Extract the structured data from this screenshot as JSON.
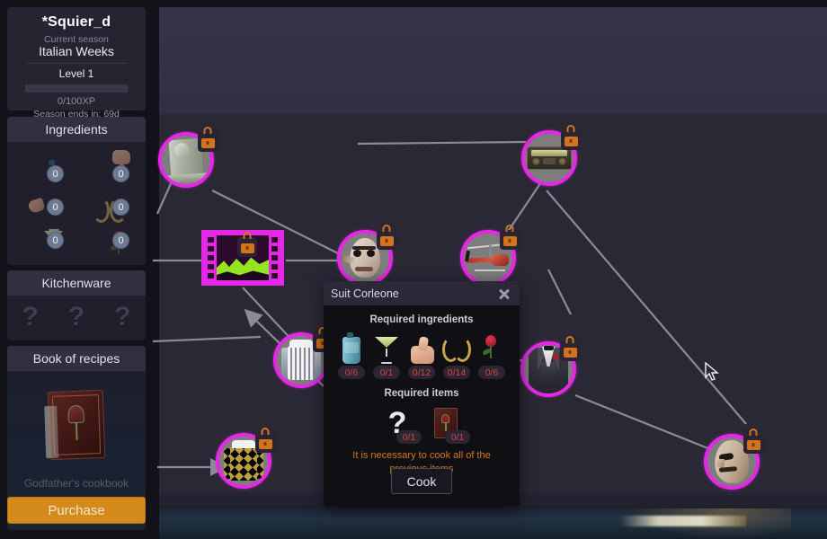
{
  "profile": {
    "name": "*Squier_d",
    "season_label": "Current season",
    "season_name": "Italian Weeks",
    "level": "Level 1",
    "xp_text": "0/100XP",
    "xp_percent": 0,
    "season_ends": "Season ends in: 69d"
  },
  "sidebar": {
    "ingredients_title": "Ingredients",
    "kitchenware_title": "Kitchenware",
    "recipes_title": "Book of recipes",
    "ingredients": [
      {
        "icon": "water-jug-icon",
        "count": "0"
      },
      {
        "icon": "thumbs-up-icon",
        "count": "0"
      },
      {
        "icon": "pinched-fingers-icon",
        "count": "0"
      },
      {
        "icon": "laurel-wreath-icon",
        "count": "0"
      },
      {
        "icon": "martini-glass-icon",
        "count": "0"
      },
      {
        "icon": "rose-icon",
        "count": "0"
      }
    ],
    "kitchenware_slots": [
      "?",
      "?",
      "?"
    ],
    "book": {
      "title": "Godfather's cookbook",
      "purchase_label": "Purchase"
    }
  },
  "dialog": {
    "title": "Suit Corleone",
    "close_icon": "close-icon",
    "required_ingredients_title": "Required ingredients",
    "required_ingredients": [
      {
        "icon": "water-jug-icon",
        "count": "0/6"
      },
      {
        "icon": "martini-glass-icon",
        "count": "0/1"
      },
      {
        "icon": "thumbs-up-icon",
        "count": "0/12"
      },
      {
        "icon": "laurel-wreath-icon",
        "count": "0/14"
      },
      {
        "icon": "rose-icon",
        "count": "0/6"
      }
    ],
    "required_items_title": "Required items",
    "required_items": [
      {
        "icon": "unknown-item-icon",
        "count": "0/1"
      },
      {
        "icon": "cookbook-icon",
        "count": "0/1"
      }
    ],
    "warning": "It is necessary to cook all of the previous items",
    "cook_label": "Cook"
  },
  "graph": {
    "nodes": [
      {
        "id": "statue",
        "name": "node-statue",
        "locked": true
      },
      {
        "id": "film",
        "name": "node-film",
        "locked": true
      },
      {
        "id": "mask",
        "name": "node-mask",
        "locked": true
      },
      {
        "id": "boombox",
        "name": "node-boombox",
        "locked": true
      },
      {
        "id": "heli",
        "name": "node-helicopter",
        "locked": true
      },
      {
        "id": "shirt",
        "name": "node-shirt",
        "locked": true
      },
      {
        "id": "goldshirt",
        "name": "node-gold-shirt",
        "locked": true
      },
      {
        "id": "suit",
        "name": "node-suit",
        "locked": true
      },
      {
        "id": "face",
        "name": "node-face",
        "locked": true
      }
    ],
    "lock_icon": "padlock-icon",
    "cursor_icon": "mouse-cursor-icon"
  },
  "colors": {
    "node_ring": "#e528e5",
    "lock": "#d4731d",
    "purchase": "#d58a1c",
    "warning_text": "#d07a1c",
    "badge_text": "#d8453f",
    "canvas_bg": "#2b2836"
  }
}
